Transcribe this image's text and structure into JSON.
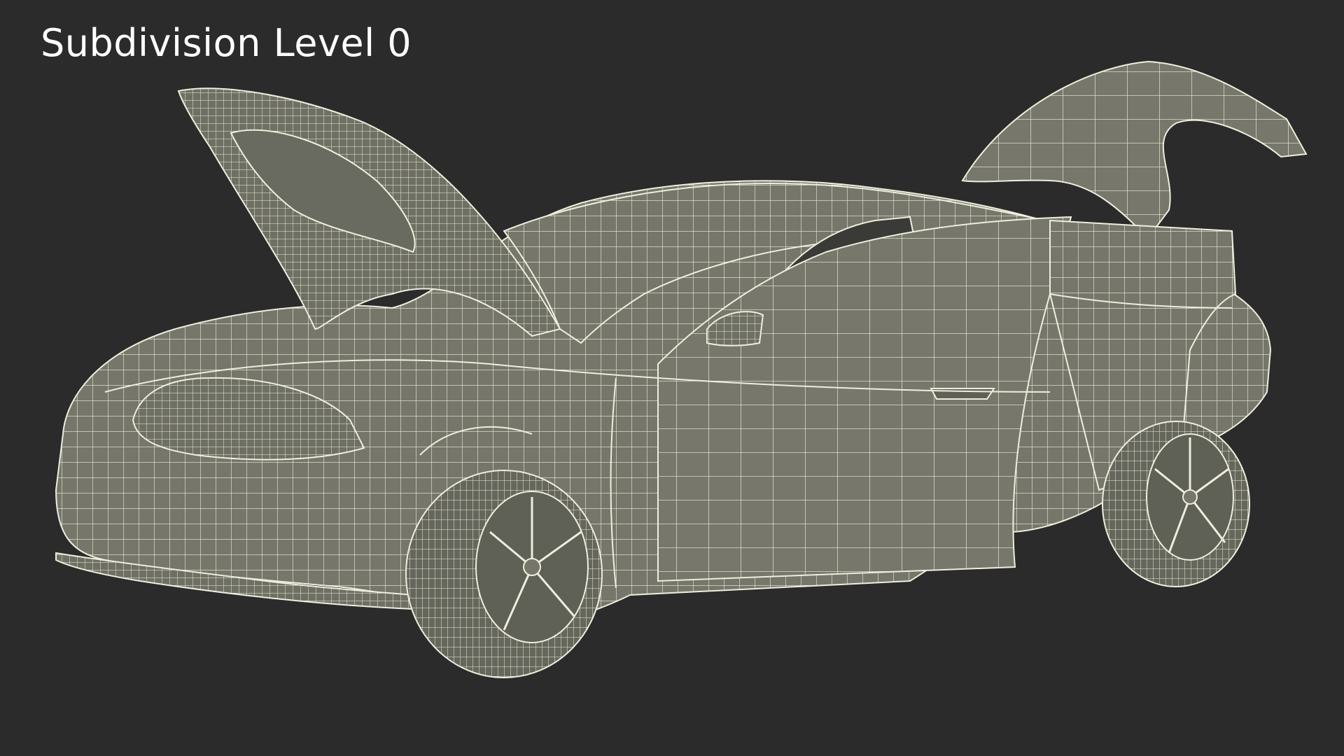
{
  "caption": "Subdivision Level 0",
  "colors": {
    "background": "#2b2b2b",
    "surface": "#76776a",
    "surface_dark": "#5f6056",
    "wire": "#efeedd",
    "caption": "#ffffff"
  },
  "subject": "wireframe-car-model-icon"
}
